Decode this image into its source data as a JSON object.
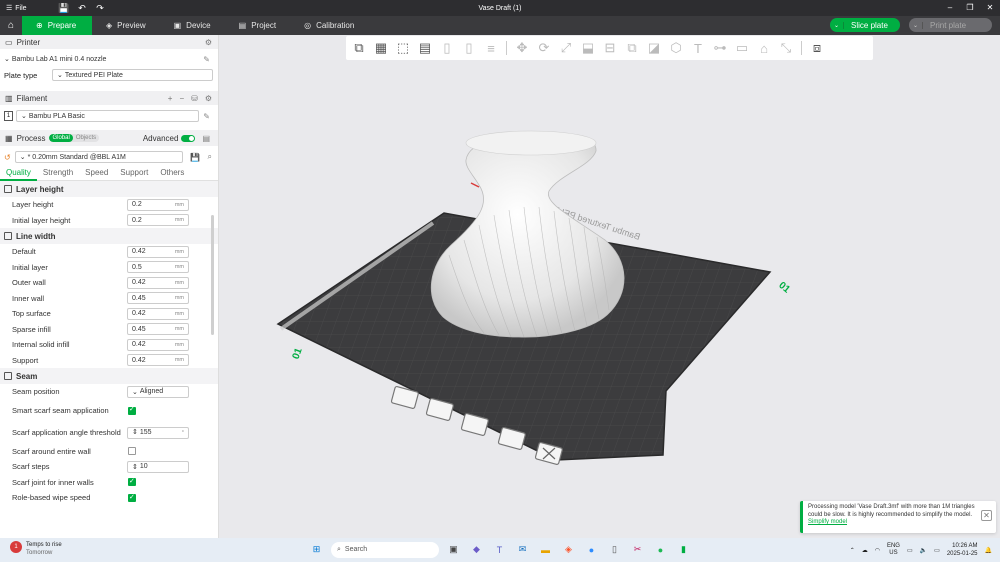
{
  "titlebar": {
    "menu_label": "File",
    "title": "Vase Draft (1)"
  },
  "tabs": [
    {
      "label": "Prepare",
      "icon": "prepare-icon"
    },
    {
      "label": "Preview",
      "icon": "preview-icon"
    },
    {
      "label": "Device",
      "icon": "device-icon"
    },
    {
      "label": "Project",
      "icon": "project-icon"
    },
    {
      "label": "Calibration",
      "icon": "calibration-icon"
    }
  ],
  "actions": {
    "slice_label": "Slice plate",
    "print_label": "Print plate"
  },
  "printer": {
    "section_label": "Printer",
    "name": "Bambu Lab A1 mini 0.4 nozzle",
    "plate_type_label": "Plate type",
    "plate_type": "Textured PEI Plate"
  },
  "filament": {
    "section_label": "Filament",
    "slot": "1",
    "name": "Bambu PLA Basic"
  },
  "process": {
    "section_label": "Process",
    "scope_global": "Global",
    "scope_objects": "Objects",
    "advanced_label": "Advanced",
    "advanced_on": true,
    "preset": "* 0.20mm Standard @BBL A1M",
    "subtabs": [
      "Quality",
      "Strength",
      "Speed",
      "Support",
      "Others"
    ],
    "active_subtab": "Quality"
  },
  "groups": {
    "layer_height": {
      "title": "Layer height",
      "rows": [
        {
          "label": "Layer height",
          "value": "0.2",
          "unit": "mm"
        },
        {
          "label": "Initial layer height",
          "value": "0.2",
          "unit": "mm"
        }
      ]
    },
    "line_width": {
      "title": "Line width",
      "rows": [
        {
          "label": "Default",
          "value": "0.42",
          "unit": "mm"
        },
        {
          "label": "Initial layer",
          "value": "0.5",
          "unit": "mm"
        },
        {
          "label": "Outer wall",
          "value": "0.42",
          "unit": "mm"
        },
        {
          "label": "Inner wall",
          "value": "0.45",
          "unit": "mm"
        },
        {
          "label": "Top surface",
          "value": "0.42",
          "unit": "mm"
        },
        {
          "label": "Sparse infill",
          "value": "0.45",
          "unit": "mm"
        },
        {
          "label": "Internal solid infill",
          "value": "0.42",
          "unit": "mm"
        },
        {
          "label": "Support",
          "value": "0.42",
          "unit": "mm"
        }
      ]
    },
    "seam": {
      "title": "Seam",
      "seam_position_label": "Seam position",
      "seam_position": "Aligned",
      "smart_scarf_label": "Smart scarf seam application",
      "smart_scarf": true,
      "scarf_angle_label": "Scarf application angle threshold",
      "scarf_angle": "155",
      "scarf_entire_label": "Scarf around entire wall",
      "scarf_entire": false,
      "scarf_steps_label": "Scarf steps",
      "scarf_steps": "10",
      "scarf_inner_label": "Scarf joint for inner walls",
      "scarf_inner": true,
      "role_wipe_label": "Role-based wipe speed",
      "role_wipe": true
    }
  },
  "plate": {
    "label_front": "01",
    "label_side": "01",
    "plate_text": "Bambu Textured PEI Plate"
  },
  "notification": {
    "text": "Processing model 'Vase Draft.3mf' with more than 1M triangles could be slow. It is highly recommended to simplify the model.",
    "link": "Simplify model"
  },
  "taskbar": {
    "weather_title": "Temps to rise",
    "weather_sub": "Tomorrow",
    "weather_badge": "1",
    "search_placeholder": "Search",
    "lang": "ENG",
    "region": "US",
    "time": "10:26 AM",
    "date": "2025-01-25"
  },
  "colors": {
    "accent": "#00ae42",
    "plate": "#3c3c3e",
    "viewport_bg": "#e9e9ec"
  }
}
